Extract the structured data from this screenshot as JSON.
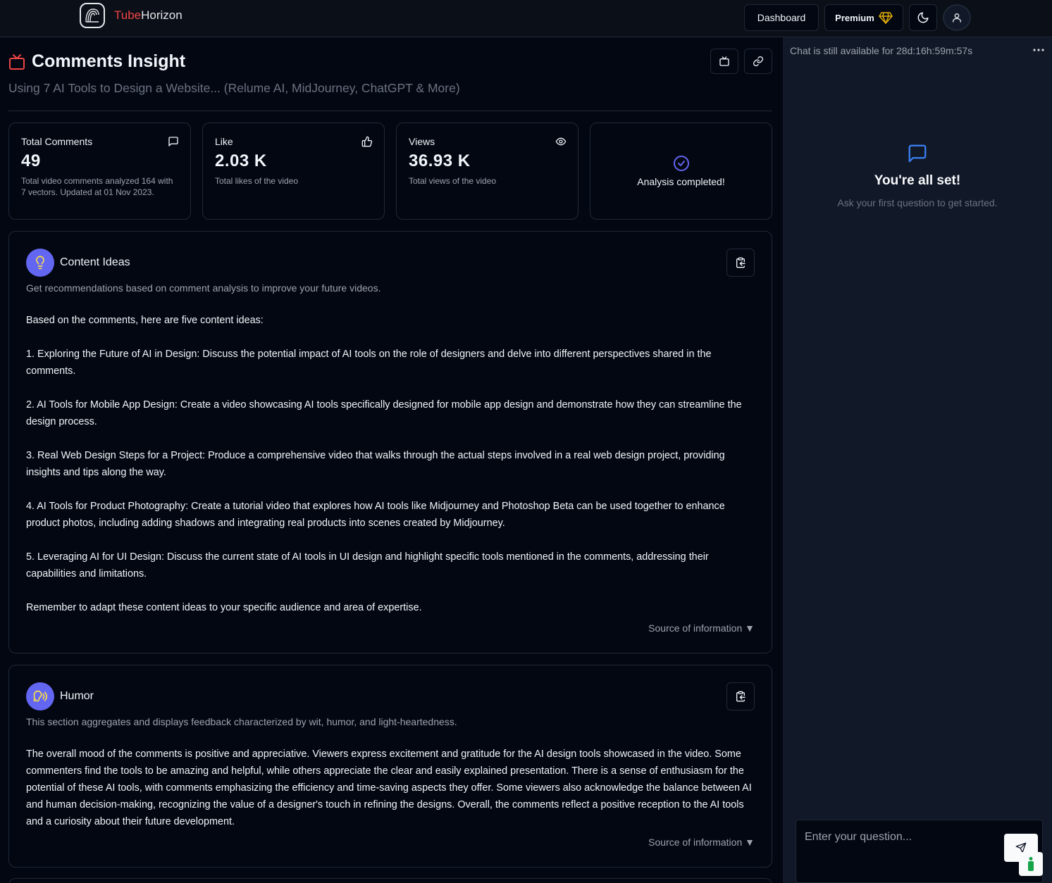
{
  "brand": {
    "part1": "Tube",
    "part2": "Horizon"
  },
  "nav": {
    "dashboard": "Dashboard",
    "premium": "Premium"
  },
  "page": {
    "title": "Comments Insight",
    "subtitle": "Using 7 AI Tools to Design a Website... (Relume AI, MidJourney, ChatGPT & More)"
  },
  "stats": [
    {
      "label": "Total Comments",
      "value": "49",
      "desc": "Total video comments analyzed 164 with 7 vectors. Updated at 01 Nov 2023.",
      "icon": "message-square-icon"
    },
    {
      "label": "Like",
      "value": "2.03 K",
      "desc": "Total likes of the video",
      "icon": "thumbs-up-icon"
    },
    {
      "label": "Views",
      "value": "36.93 K",
      "desc": "Total views of the video",
      "icon": "eye-icon"
    },
    {
      "status": "Analysis completed!",
      "icon": "check-circle-icon"
    }
  ],
  "ideas": {
    "title": "Content Ideas",
    "subtitle": "Get recommendations based on comment analysis to improve your future videos.",
    "intro": "Based on the comments, here are five content ideas:",
    "items": [
      "1. Exploring the Future of AI in Design: Discuss the potential impact of AI tools on the role of designers and delve into different perspectives shared in the comments.",
      "2. AI Tools for Mobile App Design: Create a video showcasing AI tools specifically designed for mobile app design and demonstrate how they can streamline the design process.",
      "3. Real Web Design Steps for a Project: Produce a comprehensive video that walks through the actual steps involved in a real web design project, providing insights and tips along the way.",
      "4. AI Tools for Product Photography: Create a tutorial video that explores how AI tools like Midjourney and Photoshop Beta can be used together to enhance product photos, including adding shadows and integrating real products into scenes created by Midjourney.",
      "5. Leveraging AI for UI Design: Discuss the current state of AI tools in UI design and highlight specific tools mentioned in the comments, addressing their capabilities and limitations."
    ],
    "outro": "Remember to adapt these content ideas to your specific audience and area of expertise.",
    "source": "Source of information ▼"
  },
  "humor": {
    "title": "Humor",
    "subtitle": "This section aggregates and displays feedback characterized by wit, humor, and light-heartedness.",
    "body": "The overall mood of the comments is positive and appreciative. Viewers express excitement and gratitude for the AI design tools showcased in the video. Some commenters find the tools to be amazing and helpful, while others appreciate the clear and easily explained presentation. There is a sense of enthusiasm for the potential of these AI tools, with comments emphasizing the efficiency and time-saving aspects they offer. Some viewers also acknowledge the balance between AI and human decision-making, recognizing the value of a designer's touch in refining the designs. Overall, the comments reflect a positive reception to the AI tools and a curiosity about their future development.",
    "source": "Source of information ▼"
  },
  "chat": {
    "timer": "Chat is still available for 28d:16h:59m:57s",
    "empty_title": "You're all set!",
    "empty_sub": "Ask your first question to get started.",
    "placeholder": "Enter your question..."
  },
  "colors": {
    "accent": "#6366f1",
    "brand_red": "#ef4444",
    "background": "#030712",
    "panel": "#111827",
    "premium_gold": "#eab308"
  }
}
